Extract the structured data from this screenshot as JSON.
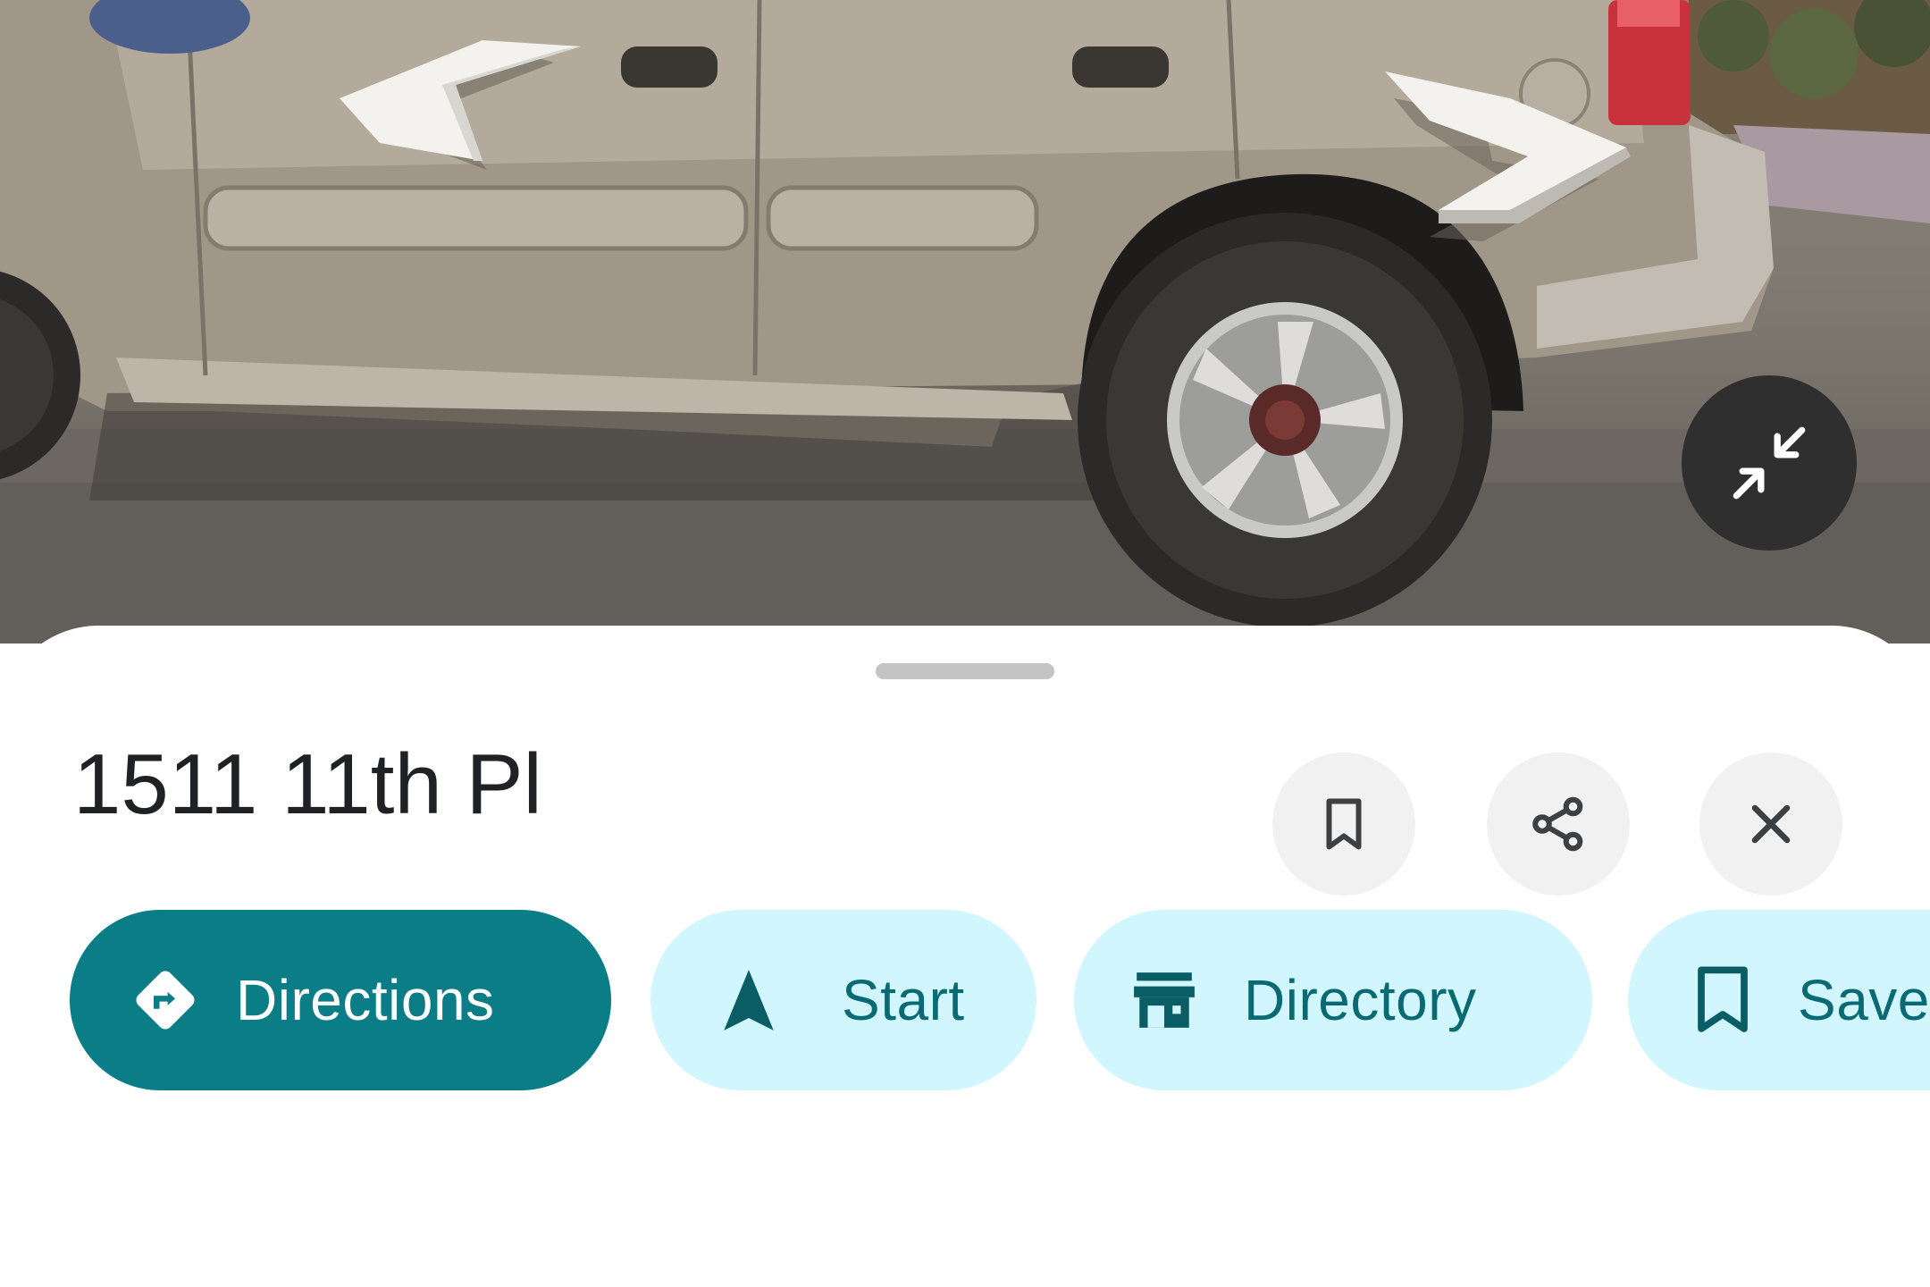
{
  "street_view": {
    "nav_left_icon": "chevron-left-arrow-icon",
    "nav_right_icon": "chevron-right-arrow-icon",
    "collapse_icon": "collapse-arrows-icon"
  },
  "place": {
    "title": "1511 11th Pl"
  },
  "header_actions": {
    "bookmark_icon": "bookmark-icon",
    "share_icon": "share-icon",
    "close_icon": "close-icon"
  },
  "chips": [
    {
      "label": "Directions",
      "icon": "directions-icon"
    },
    {
      "label": "Start",
      "icon": "navigation-arrow-icon"
    },
    {
      "label": "Directory",
      "icon": "storefront-icon"
    },
    {
      "label": "Save",
      "icon": "bookmark-icon"
    }
  ],
  "colors": {
    "primary_chip": "#0b7d86",
    "secondary_chip": "#d2f6fe",
    "secondary_chip_text": "#0a6a73",
    "title_text": "#202124"
  }
}
